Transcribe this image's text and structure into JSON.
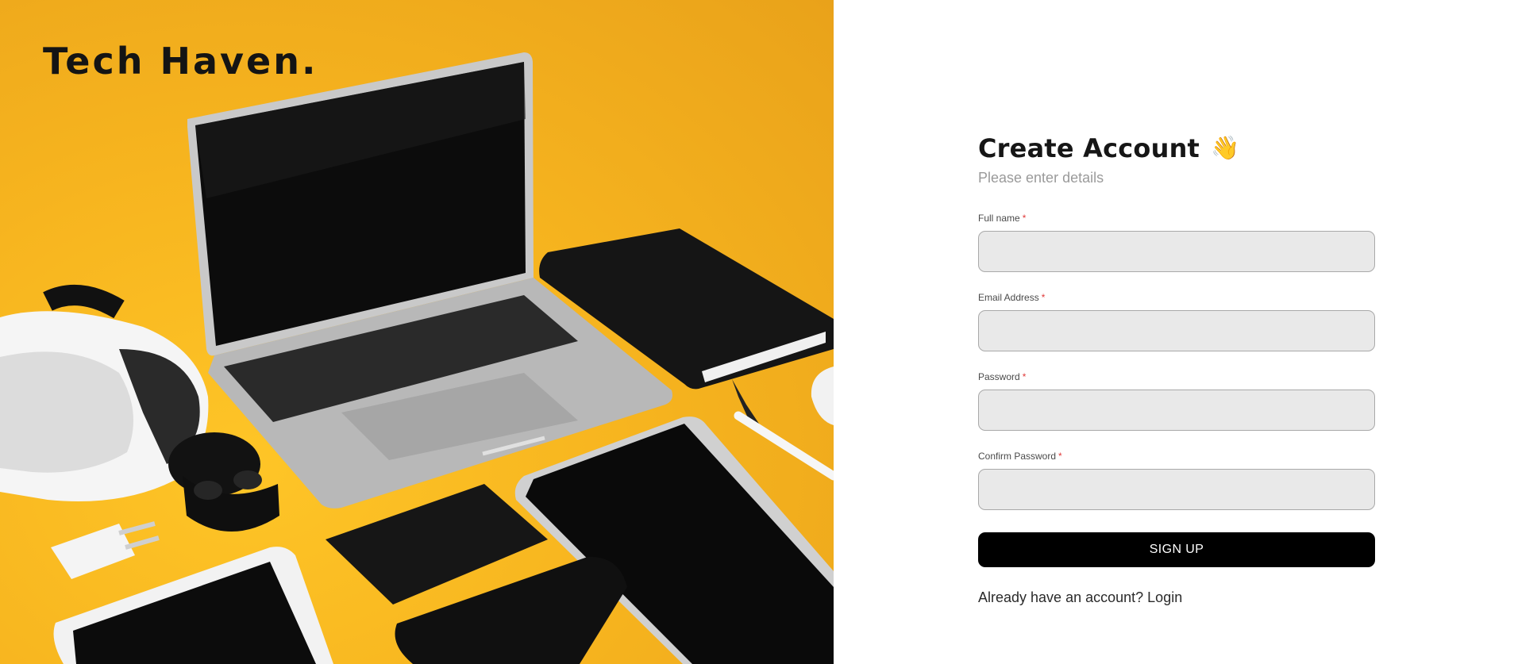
{
  "hero": {
    "brand": "Tech Haven.",
    "photo": "tech-gadgets-on-yellow-background",
    "background_color": "#f7b51f"
  },
  "form": {
    "title": "Create Account",
    "title_emoji": "👋",
    "subtitle": "Please enter details",
    "required_marker": "*",
    "fields": [
      {
        "label": "Full name",
        "value": "",
        "type": "text"
      },
      {
        "label": "Email Address",
        "value": "",
        "type": "email"
      },
      {
        "label": "Password",
        "value": "",
        "type": "password"
      },
      {
        "label": "Confirm Password",
        "value": "",
        "type": "password"
      }
    ],
    "submit_label": "SIGN UP",
    "login_prompt": "Already have an account?",
    "login_link": "Login"
  },
  "colors": {
    "accent": "#000000",
    "required": "#e03a3a",
    "input_background": "#e9e9e9"
  }
}
